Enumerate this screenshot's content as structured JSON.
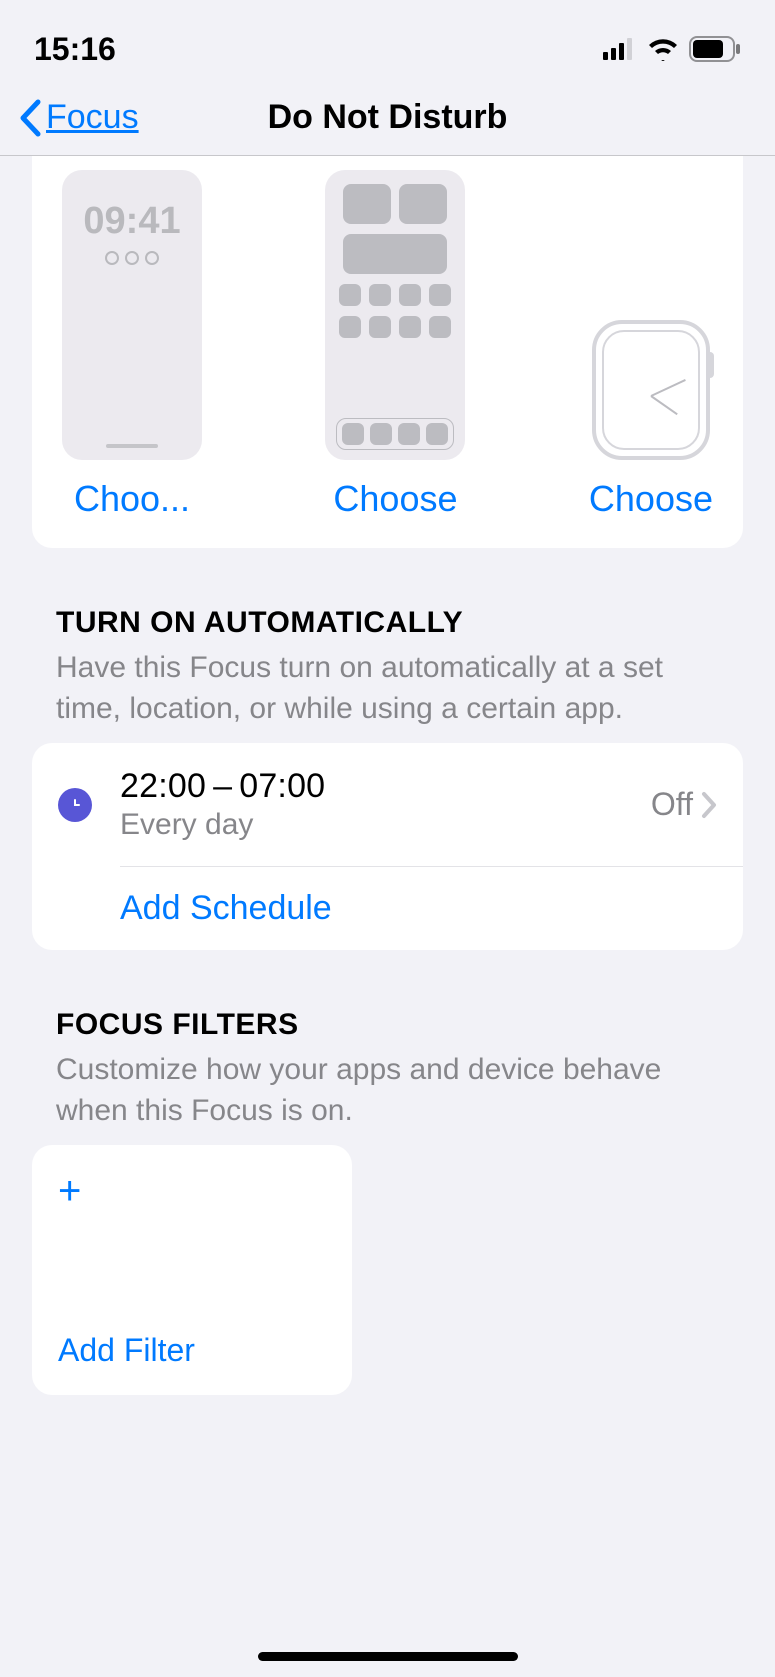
{
  "statusbar": {
    "time": "15:16"
  },
  "nav": {
    "back": "Focus",
    "title": "Do Not Disturb"
  },
  "lockscreen_preview_time": "09:41",
  "choose_labels": {
    "lock": "Choo...",
    "home": "Choose",
    "watch": "Choose"
  },
  "auto": {
    "header": "TURN ON AUTOMATICALLY",
    "desc": "Have this Focus turn on automatically at a set time, location, or while using a certain app.",
    "schedule": {
      "range": "22:00 – 07:00",
      "repeat": "Every day",
      "state": "Off"
    },
    "add": "Add Schedule"
  },
  "filters": {
    "header": "FOCUS FILTERS",
    "desc": "Customize how your apps and device behave when this Focus is on.",
    "add": "Add Filter"
  }
}
